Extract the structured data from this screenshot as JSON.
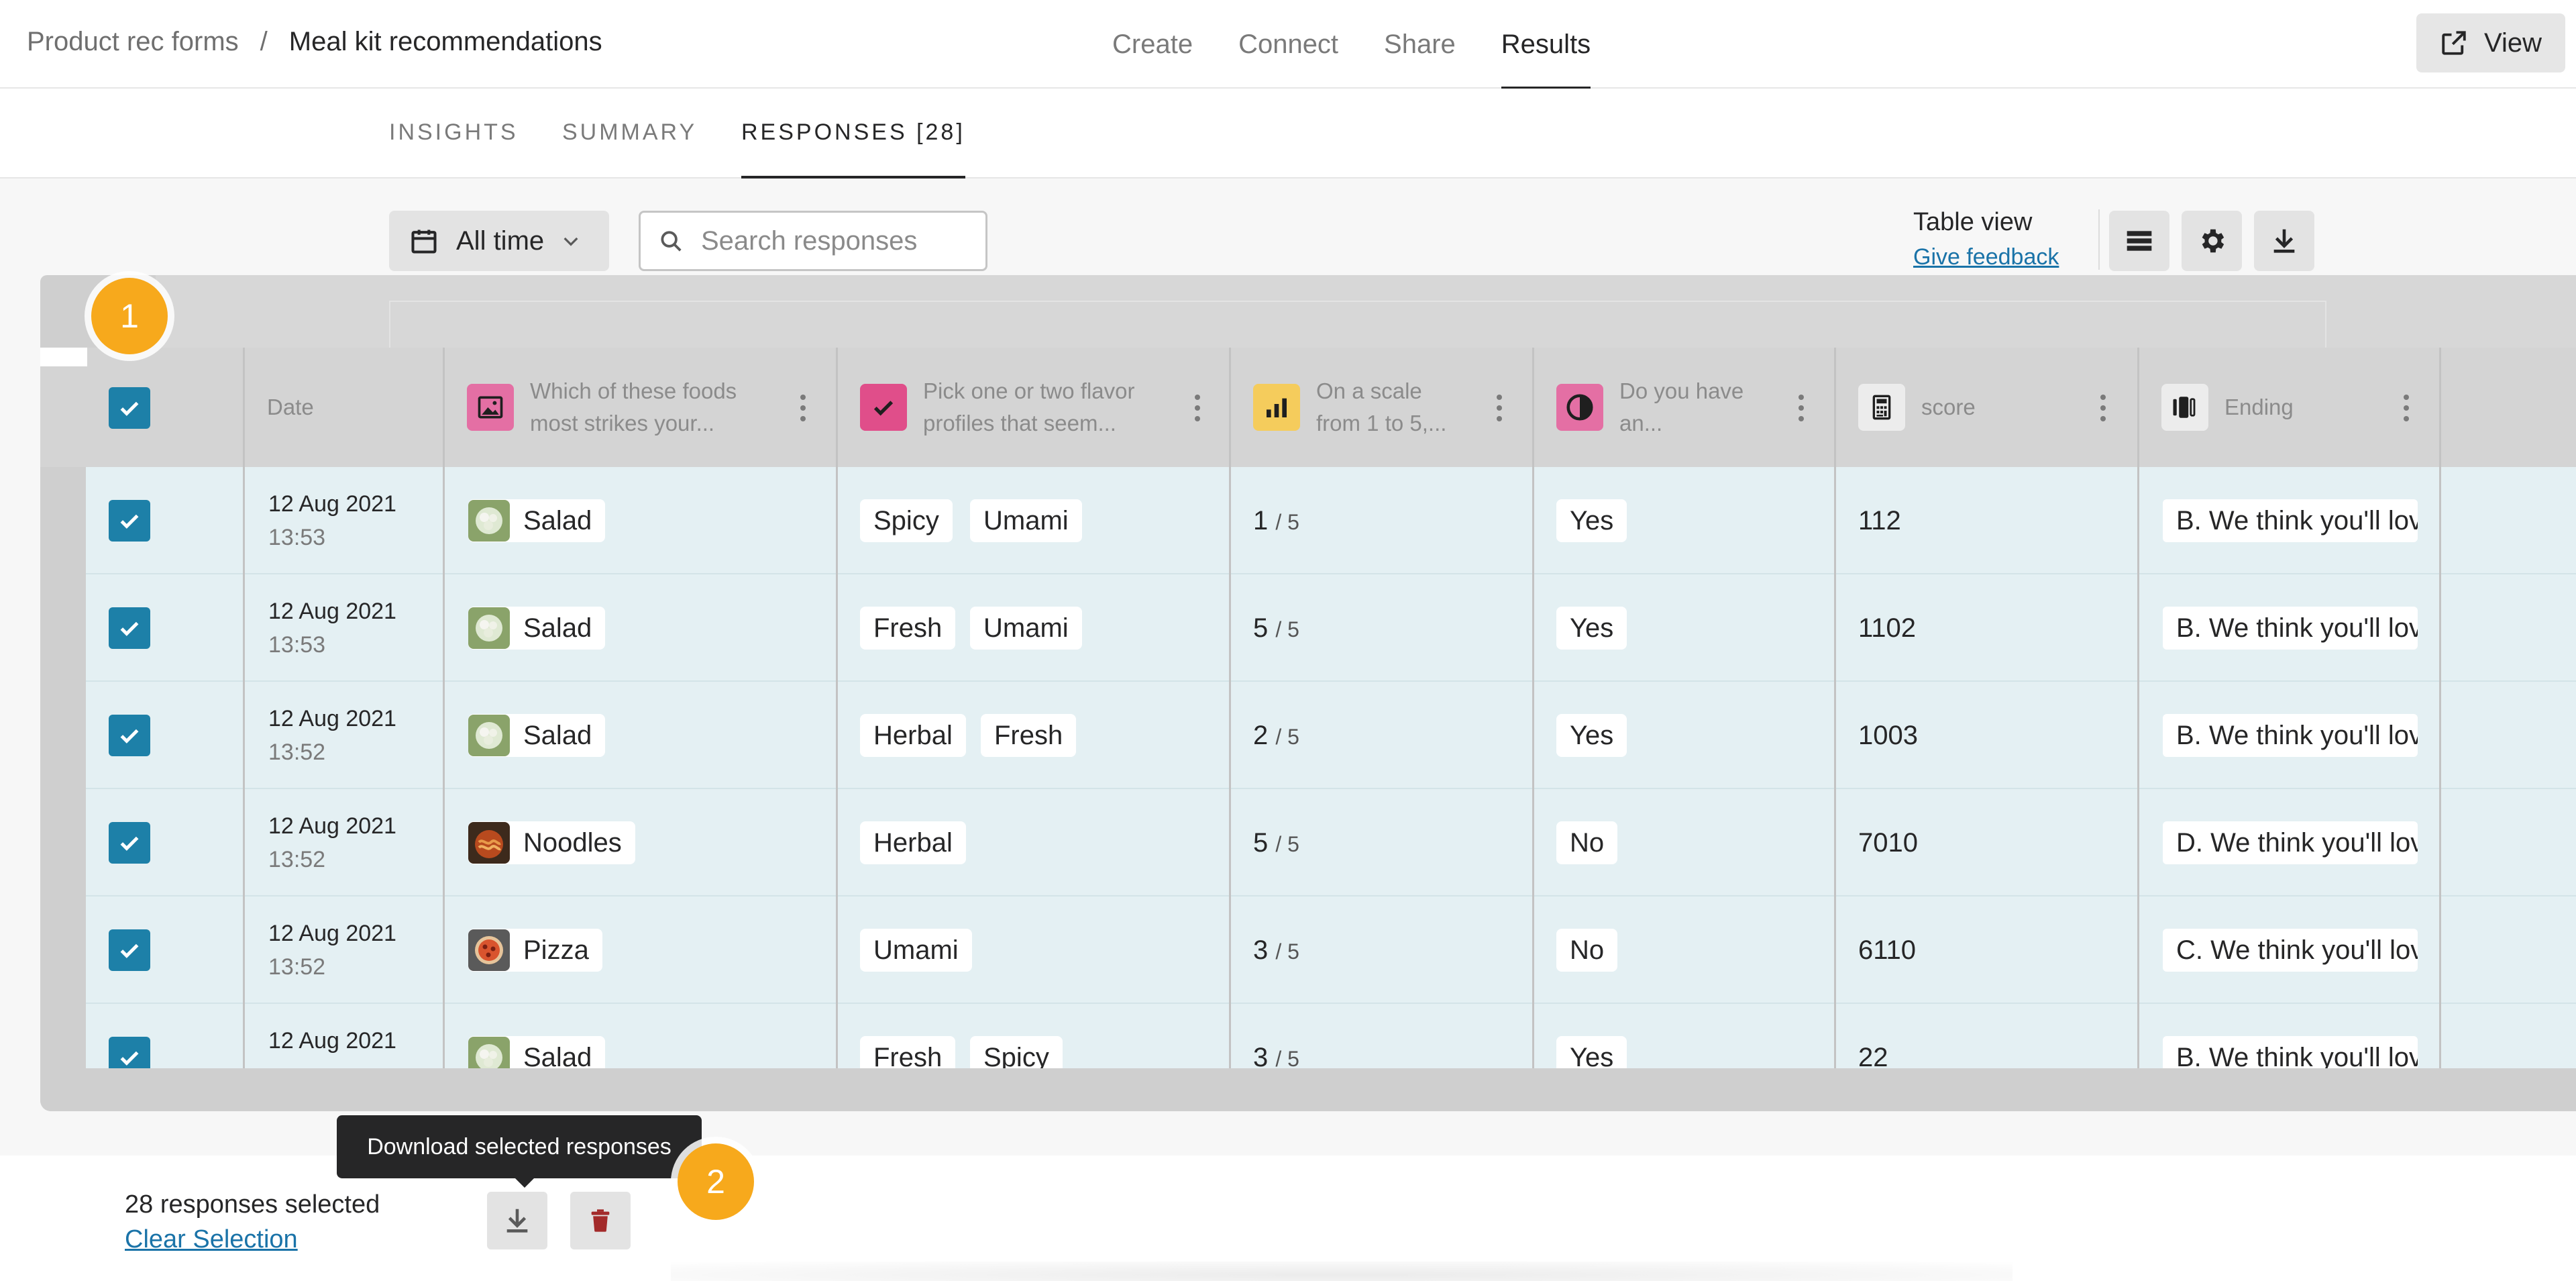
{
  "header": {
    "breadcrumb_root": "Product rec forms",
    "breadcrumb_separator": "/",
    "breadcrumb_current": "Meal kit recommendations",
    "nav": [
      "Create",
      "Connect",
      "Share",
      "Results"
    ],
    "active_nav": "Results",
    "view_label": "View"
  },
  "subtabs": {
    "items": [
      "INSIGHTS",
      "SUMMARY",
      "RESPONSES [28]"
    ],
    "active": "RESPONSES [28]"
  },
  "toolbar": {
    "date_filter": "All time",
    "search_placeholder": "Search responses",
    "table_view_label": "Table view",
    "give_feedback": "Give feedback"
  },
  "table": {
    "columns": {
      "date": "Date",
      "q1": "Which of these foods most strikes your...",
      "q2": "Pick one or two flavor profiles that seem...",
      "q3": "On a scale from 1 to 5,...",
      "q4": "Do you have an...",
      "score": "score",
      "ending": "Ending"
    },
    "rows": [
      {
        "date": "12 Aug 2021",
        "time": "13:53",
        "food": "Salad",
        "flavors": [
          "Spicy",
          "Umami"
        ],
        "scale": "1",
        "scale_max": "/ 5",
        "yesno": "Yes",
        "score": "112",
        "ending": "B. We think you'll love"
      },
      {
        "date": "12 Aug 2021",
        "time": "13:53",
        "food": "Salad",
        "flavors": [
          "Fresh",
          "Umami"
        ],
        "scale": "5",
        "scale_max": "/ 5",
        "yesno": "Yes",
        "score": "1102",
        "ending": "B. We think you'll love"
      },
      {
        "date": "12 Aug 2021",
        "time": "13:52",
        "food": "Salad",
        "flavors": [
          "Herbal",
          "Fresh"
        ],
        "scale": "2",
        "scale_max": "/ 5",
        "yesno": "Yes",
        "score": "1003",
        "ending": "B. We think you'll love"
      },
      {
        "date": "12 Aug 2021",
        "time": "13:52",
        "food": "Noodles",
        "flavors": [
          "Herbal"
        ],
        "scale": "5",
        "scale_max": "/ 5",
        "yesno": "No",
        "score": "7010",
        "ending": "D. We think you'll love"
      },
      {
        "date": "12 Aug 2021",
        "time": "13:52",
        "food": "Pizza",
        "flavors": [
          "Umami"
        ],
        "scale": "3",
        "scale_max": "/ 5",
        "yesno": "No",
        "score": "6110",
        "ending": "C. We think you'll love"
      },
      {
        "date": "12 Aug 2021",
        "time": "",
        "food": "Salad",
        "flavors": [
          "Fresh",
          "Spicy"
        ],
        "scale": "3",
        "scale_max": "/ 5",
        "yesno": "Yes",
        "score": "22",
        "ending": "B. We think you'll love"
      }
    ]
  },
  "selection": {
    "count_label": "28 responses selected",
    "clear_label": "Clear Selection",
    "tooltip": "Download selected responses"
  },
  "markers": [
    "1",
    "2"
  ],
  "colors": {
    "accent_blue": "#1d80a8",
    "marker_orange": "#f7a91c",
    "row_bg": "#e4f0f3",
    "delete_red": "#a32a2a",
    "picture_badge": "#e46fa4",
    "multi_badge": "#e04e8a",
    "scale_badge": "#f5cc5c",
    "yesno_badge": "#e46fa4"
  }
}
